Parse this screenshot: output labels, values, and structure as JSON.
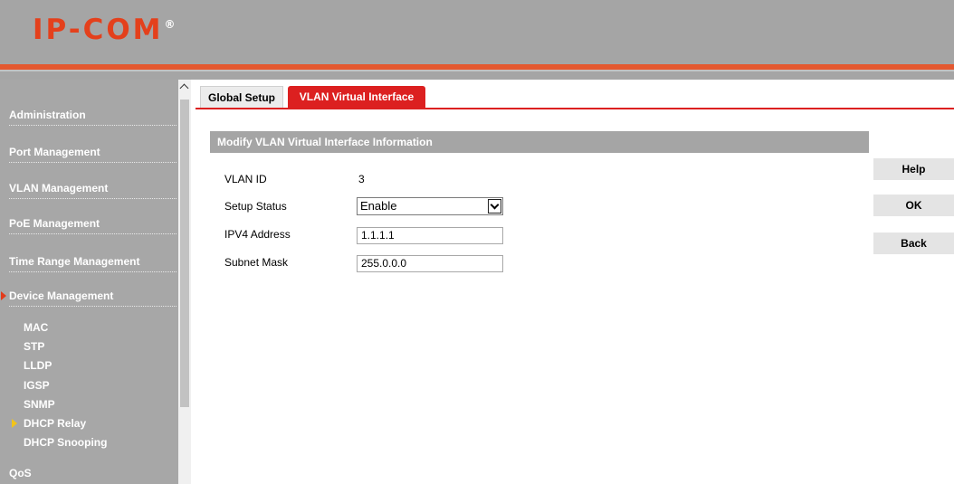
{
  "header": {
    "logo_text": "IP-COM",
    "logo_mark": "®",
    "colors": {
      "accent": "#e4401c",
      "stripe": "#e45830",
      "header_bg": "#a5a5a5",
      "tab_active": "#dc2020"
    }
  },
  "sidebar": {
    "items": [
      {
        "label": "Administration"
      },
      {
        "label": "Port Management"
      },
      {
        "label": "VLAN Management"
      },
      {
        "label": "PoE Management"
      },
      {
        "label": "Time Range Management"
      },
      {
        "label": "Device Management",
        "expanded": true,
        "icon": "triangle-right-icon"
      }
    ],
    "sub_items": [
      {
        "label": "MAC"
      },
      {
        "label": "STP"
      },
      {
        "label": "LLDP"
      },
      {
        "label": "IGSP"
      },
      {
        "label": "SNMP"
      },
      {
        "label": "DHCP Relay",
        "active": true,
        "icon": "triangle-right-icon"
      },
      {
        "label": "DHCP Snooping"
      }
    ],
    "qos_label": "QoS"
  },
  "scrollbar": {
    "up_icon": "chevron-up-icon"
  },
  "tabs": [
    {
      "label": "Global Setup",
      "active": false
    },
    {
      "label": "VLAN Virtual Interface",
      "active": true
    }
  ],
  "form": {
    "title": "Modify VLAN Virtual Interface Information",
    "vlan_id": {
      "label": "VLAN ID",
      "value": "3"
    },
    "setup_status": {
      "label": "Setup Status",
      "value": "Enable"
    },
    "ipv4": {
      "label": "IPV4 Address",
      "value": "1.1.1.1"
    },
    "mask": {
      "label": "Subnet Mask",
      "value": "255.0.0.0"
    }
  },
  "buttons": {
    "help": "Help",
    "ok": "OK",
    "back": "Back"
  }
}
